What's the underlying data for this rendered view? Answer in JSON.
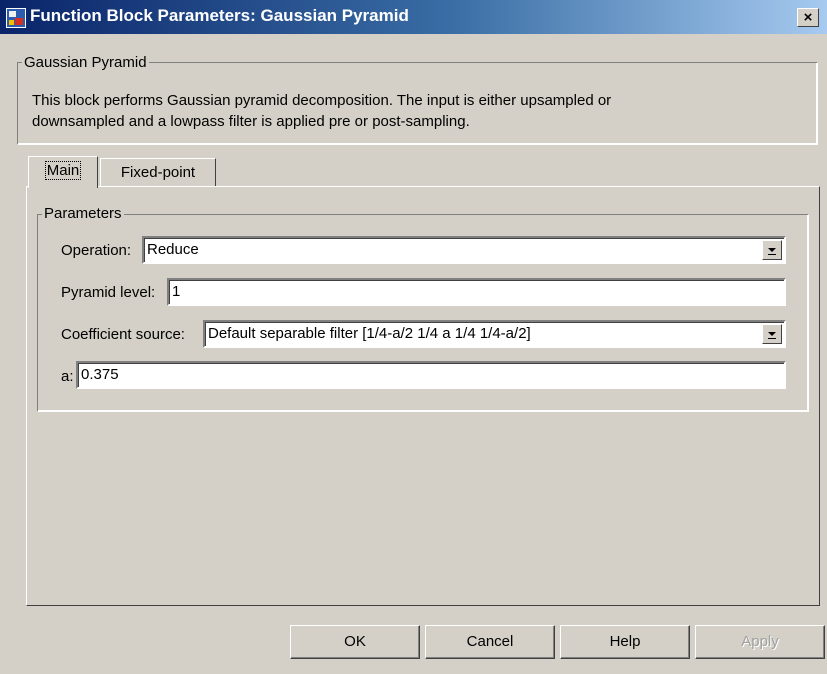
{
  "window": {
    "title": "Function Block Parameters: Gaussian Pyramid",
    "close_label": "×"
  },
  "block": {
    "group_title": "Gaussian Pyramid",
    "description_line1": "This block performs Gaussian pyramid decomposition.  The input is either upsampled or",
    "description_line2": "downsampled and a lowpass filter is applied pre or post-sampling."
  },
  "tabs": [
    {
      "label": "Main",
      "active": true
    },
    {
      "label": "Fixed-point",
      "active": false
    }
  ],
  "parameters": {
    "group_title": "Parameters",
    "operation": {
      "label": "Operation:",
      "value": "Reduce"
    },
    "pyramid_level": {
      "label": "Pyramid level:",
      "value": "1"
    },
    "coefficient_source": {
      "label": "Coefficient source:",
      "value": "Default separable filter [1/4-a/2  1/4  a  1/4  1/4-a/2]"
    },
    "a": {
      "label": "a:",
      "value": "0.375"
    }
  },
  "buttons": {
    "ok": "OK",
    "cancel": "Cancel",
    "help": "Help",
    "apply": "Apply"
  },
  "icons": {
    "app": "simulink-block-icon",
    "close": "close-icon",
    "dropdown": "chevron-down-icon"
  }
}
